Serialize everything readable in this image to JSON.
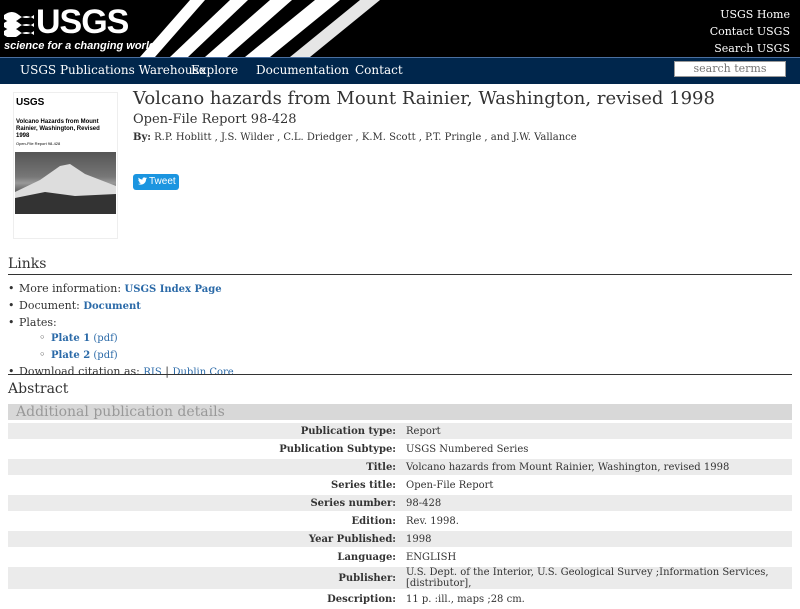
{
  "header": {
    "logo_text": "USGS",
    "tagline": "science for a changing world",
    "top_links": [
      "USGS Home",
      "Contact USGS",
      "Search USGS"
    ]
  },
  "nav": {
    "items": [
      "USGS Publications Warehouse",
      "Explore",
      "Documentation",
      "Contact"
    ],
    "search_placeholder": "search terms"
  },
  "cover": {
    "logo": "USGS",
    "title": "Volcano Hazards from Mount Rainier, Washington, Revised 1998",
    "report": "Open-File Report 98-428"
  },
  "publication": {
    "title": "Volcano hazards from Mount Rainier, Washington, revised 1998",
    "series": "Open-File Report 98-428",
    "by_label": "By:",
    "authors": "R.P. Hoblitt , J.S. Wilder , C.L. Driedger , K.M. Scott , P.T. Pringle , and J.W. Vallance",
    "tweet_label": "Tweet"
  },
  "links": {
    "heading": "Links",
    "more_info_label": "More information:",
    "more_info_link": "USGS Index Page",
    "document_label": "Document:",
    "document_link": "Document",
    "plates_label": "Plates:",
    "plates": [
      {
        "name": "Plate 1",
        "type": "(pdf)"
      },
      {
        "name": "Plate 2",
        "type": "(pdf)"
      }
    ],
    "citation_label": "Download citation as:",
    "ris": "RIS",
    "separator": "|",
    "dublin": "Dublin Core"
  },
  "abstract_heading": "Abstract",
  "details_heading": "Additional publication details",
  "details": [
    {
      "key": "Publication type:",
      "value": "Report"
    },
    {
      "key": "Publication Subtype:",
      "value": "USGS Numbered Series"
    },
    {
      "key": "Title:",
      "value": "Volcano hazards from Mount Rainier, Washington, revised 1998"
    },
    {
      "key": "Series title:",
      "value": "Open-File Report"
    },
    {
      "key": "Series number:",
      "value": "98-428"
    },
    {
      "key": "Edition:",
      "value": "Rev. 1998."
    },
    {
      "key": "Year Published:",
      "value": "1998"
    },
    {
      "key": "Language:",
      "value": "ENGLISH"
    },
    {
      "key": "Publisher:",
      "value": "U.S. Dept. of the Interior, U.S. Geological Survey ;Information Services, [distributor],"
    },
    {
      "key": "Description:",
      "value": "11 p. :ill., maps ;28 cm."
    }
  ],
  "colors": {
    "nav_bg": "#00264c",
    "link": "#2b6aa8",
    "tweet": "#1b95e0"
  }
}
